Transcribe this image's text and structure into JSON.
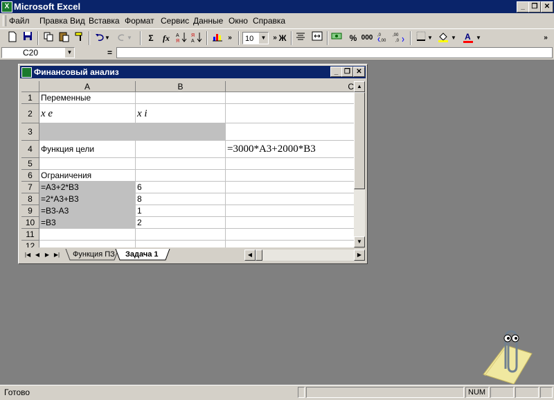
{
  "app": {
    "title": "Microsoft Excel",
    "icon": "excel-icon"
  },
  "window_buttons": {
    "minimize": "_",
    "restore": "❐",
    "close": "✕"
  },
  "menu": [
    "Файл",
    "Правка",
    "Вид",
    "Вставка",
    "Формат",
    "Сервис",
    "Данные",
    "Окно",
    "Справка"
  ],
  "toolbar": {
    "font_size": "10",
    "bold": "Ж",
    "percent": "%",
    "thousands": "000",
    "sum": "Σ",
    "function": "fx"
  },
  "formula_bar": {
    "name_box": "C20",
    "equals": "=",
    "formula": ""
  },
  "workbook": {
    "title": "Финансовый анализ",
    "columns": [
      "A",
      "B",
      "C"
    ],
    "rows": [
      "1",
      "2",
      "3",
      "4",
      "5",
      "6",
      "7",
      "8",
      "9",
      "10",
      "11",
      "12"
    ],
    "cells": {
      "A1": "Переменные",
      "A2": "x e",
      "B2": "x i",
      "A4": "Функция цели",
      "C4": "=3000*A3+2000*B3",
      "A6": "Ограничения",
      "A7": "=A3+2*B3",
      "B7": "6",
      "A8": "=2*A3+B3",
      "B8": "8",
      "A9": "=B3-A3",
      "B9": "1",
      "A10": "=B3",
      "B10": "2"
    },
    "sheets": [
      "Функция ПЗ",
      "Задача 1"
    ],
    "active_sheet": "Задача 1"
  },
  "status": {
    "text": "Готово",
    "num": "NUM"
  },
  "colors": {
    "title_bg": "#0a246a",
    "chrome": "#d4d0c8",
    "workspace": "#808080",
    "shaded": "#c0c0c0"
  }
}
